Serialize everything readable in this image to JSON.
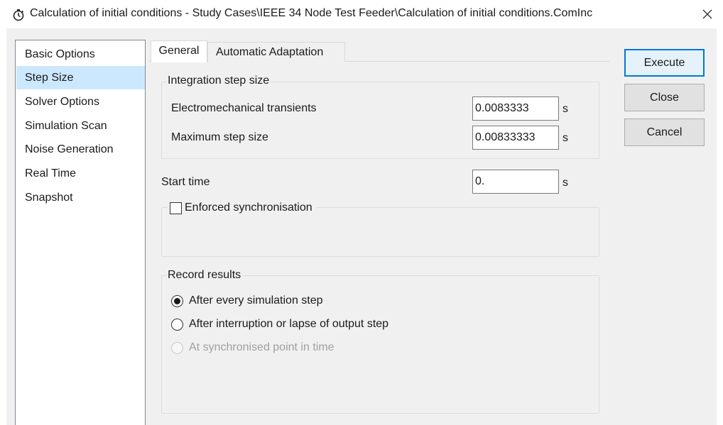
{
  "window": {
    "title": "Calculation of initial conditions - Study Cases\\IEEE 34 Node Test Feeder\\Calculation of initial conditions.ComInc",
    "app_icon": "stopwatch-icon",
    "close_icon": "close-icon"
  },
  "sidebar": {
    "items": [
      {
        "label": "Basic Options",
        "selected": false
      },
      {
        "label": "Step Size",
        "selected": true
      },
      {
        "label": "Solver Options",
        "selected": false
      },
      {
        "label": "Simulation Scan",
        "selected": false
      },
      {
        "label": "Noise Generation",
        "selected": false
      },
      {
        "label": "Real Time",
        "selected": false
      },
      {
        "label": "Snapshot",
        "selected": false
      }
    ]
  },
  "tabs": [
    {
      "label": "General",
      "active": true
    },
    {
      "label": "Automatic Adaptation",
      "active": false
    }
  ],
  "integration": {
    "group_title": "Integration step size",
    "electromechanical": {
      "label": "Electromechanical transients",
      "value": "0.0083333",
      "unit": "s"
    },
    "max_step": {
      "label": "Maximum step size",
      "value": "0.00833333",
      "unit": "s"
    }
  },
  "start_time": {
    "label": "Start time",
    "value": "0.",
    "unit": "s"
  },
  "sync": {
    "label": "Enforced synchronisation",
    "checked": false
  },
  "record": {
    "group_title": "Record results",
    "options": [
      {
        "label": "After every simulation step",
        "checked": true,
        "enabled": true
      },
      {
        "label": "After interruption or lapse of output step",
        "checked": false,
        "enabled": true
      },
      {
        "label": "At synchronised point in time",
        "checked": false,
        "enabled": false
      }
    ]
  },
  "buttons": {
    "execute": "Execute",
    "close": "Close",
    "cancel": "Cancel"
  },
  "colors": {
    "selection": "#cce8ff",
    "default_button_border": "#0078d7",
    "dialog_background": "#f0f0f0"
  }
}
